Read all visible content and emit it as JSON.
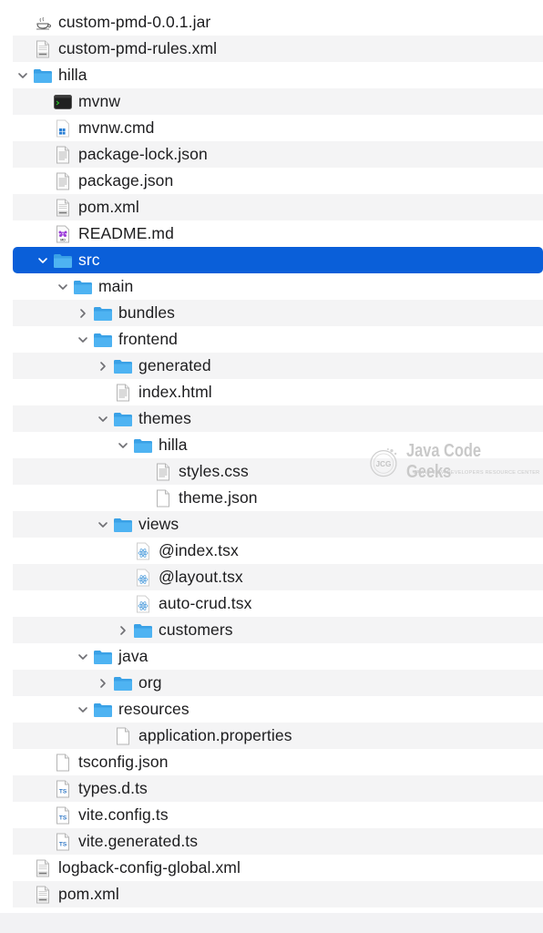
{
  "tree": [
    {
      "name": "custom-pmd-0.0.1.jar",
      "depth": 0,
      "expander": "none",
      "icon": "jar",
      "selected": false
    },
    {
      "name": "custom-pmd-rules.xml",
      "depth": 0,
      "expander": "none",
      "icon": "xml",
      "selected": false
    },
    {
      "name": "hilla",
      "depth": 0,
      "expander": "open",
      "icon": "folder",
      "selected": false
    },
    {
      "name": "mvnw",
      "depth": 1,
      "expander": "none",
      "icon": "terminal",
      "selected": false
    },
    {
      "name": "mvnw.cmd",
      "depth": 1,
      "expander": "none",
      "icon": "cmd",
      "selected": false
    },
    {
      "name": "package-lock.json",
      "depth": 1,
      "expander": "none",
      "icon": "text",
      "selected": false
    },
    {
      "name": "package.json",
      "depth": 1,
      "expander": "none",
      "icon": "text",
      "selected": false
    },
    {
      "name": "pom.xml",
      "depth": 1,
      "expander": "none",
      "icon": "xml",
      "selected": false
    },
    {
      "name": "README.md",
      "depth": 1,
      "expander": "none",
      "icon": "markdown",
      "selected": false
    },
    {
      "name": "src",
      "depth": 1,
      "expander": "open",
      "icon": "folder",
      "selected": true
    },
    {
      "name": "main",
      "depth": 2,
      "expander": "open",
      "icon": "folder",
      "selected": false
    },
    {
      "name": "bundles",
      "depth": 3,
      "expander": "closed",
      "icon": "folder",
      "selected": false
    },
    {
      "name": "frontend",
      "depth": 3,
      "expander": "open",
      "icon": "folder",
      "selected": false
    },
    {
      "name": "generated",
      "depth": 4,
      "expander": "closed",
      "icon": "folder",
      "selected": false
    },
    {
      "name": "index.html",
      "depth": 4,
      "expander": "none",
      "icon": "text",
      "selected": false
    },
    {
      "name": "themes",
      "depth": 4,
      "expander": "open",
      "icon": "folder",
      "selected": false
    },
    {
      "name": "hilla",
      "depth": 5,
      "expander": "open",
      "icon": "folder",
      "selected": false
    },
    {
      "name": "styles.css",
      "depth": 6,
      "expander": "none",
      "icon": "text",
      "selected": false
    },
    {
      "name": "theme.json",
      "depth": 6,
      "expander": "none",
      "icon": "blank",
      "selected": false
    },
    {
      "name": "views",
      "depth": 4,
      "expander": "open",
      "icon": "folder",
      "selected": false
    },
    {
      "name": "@index.tsx",
      "depth": 5,
      "expander": "none",
      "icon": "react",
      "selected": false
    },
    {
      "name": "@layout.tsx",
      "depth": 5,
      "expander": "none",
      "icon": "react",
      "selected": false
    },
    {
      "name": "auto-crud.tsx",
      "depth": 5,
      "expander": "none",
      "icon": "react",
      "selected": false
    },
    {
      "name": "customers",
      "depth": 5,
      "expander": "closed",
      "icon": "folder",
      "selected": false
    },
    {
      "name": "java",
      "depth": 3,
      "expander": "open",
      "icon": "folder",
      "selected": false
    },
    {
      "name": "org",
      "depth": 4,
      "expander": "closed",
      "icon": "folder",
      "selected": false
    },
    {
      "name": "resources",
      "depth": 3,
      "expander": "open",
      "icon": "folder",
      "selected": false
    },
    {
      "name": "application.properties",
      "depth": 4,
      "expander": "none",
      "icon": "blank",
      "selected": false
    },
    {
      "name": "tsconfig.json",
      "depth": 1,
      "expander": "none",
      "icon": "blank",
      "selected": false
    },
    {
      "name": "types.d.ts",
      "depth": 1,
      "expander": "none",
      "icon": "ts",
      "selected": false
    },
    {
      "name": "vite.config.ts",
      "depth": 1,
      "expander": "none",
      "icon": "ts",
      "selected": false
    },
    {
      "name": "vite.generated.ts",
      "depth": 1,
      "expander": "none",
      "icon": "ts",
      "selected": false
    },
    {
      "name": "logback-config-global.xml",
      "depth": 0,
      "expander": "none",
      "icon": "xml",
      "selected": false
    },
    {
      "name": "pom.xml",
      "depth": 0,
      "expander": "none",
      "icon": "xml",
      "selected": false
    }
  ],
  "watermark": {
    "brand": "Java Code Geeks",
    "logo_text": "JCG",
    "tagline": "JAVA 2 JAVA DEVELOPERS RESOURCE CENTER"
  },
  "colors": {
    "selection": "#0a5fd9",
    "folder": "#3aa1e6",
    "alt_row": "#f4f4f5",
    "watermark": "#c9c9c9"
  }
}
